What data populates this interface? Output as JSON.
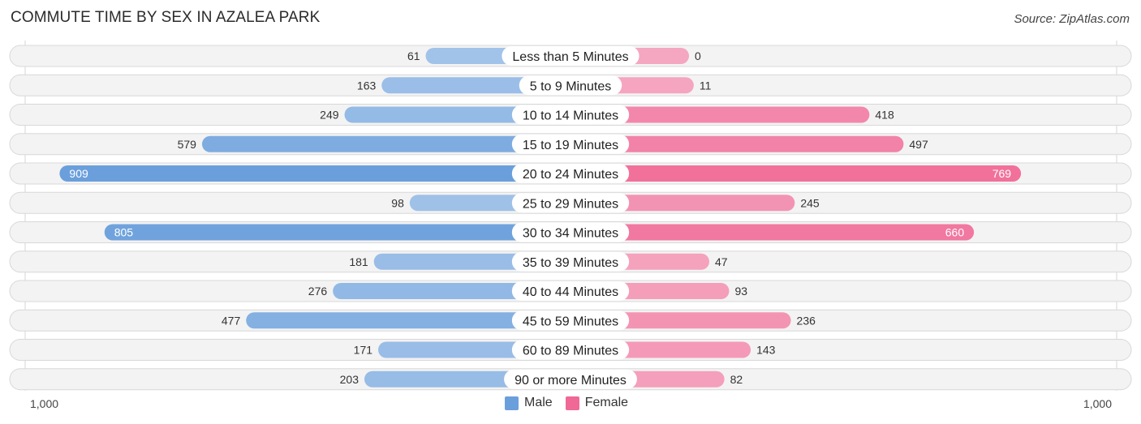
{
  "header": {
    "title": "COMMUTE TIME BY SEX IN AZALEA PARK",
    "source": "Source: ZipAtlas.com"
  },
  "colors": {
    "male_strong": "#6a9fdc",
    "male_light": "#a7c6ea",
    "female_strong": "#f06895",
    "female_light": "#f5a6c0"
  },
  "axis": {
    "left_label": "1,000",
    "right_label": "1,000"
  },
  "legend": [
    {
      "label": "Male",
      "color": "#6a9fdc"
    },
    {
      "label": "Female",
      "color": "#f06895"
    }
  ],
  "chart_data": {
    "type": "bar",
    "orientation": "horizontal-diverging",
    "title": "COMMUTE TIME BY SEX IN AZALEA PARK",
    "categories": [
      "Less than 5 Minutes",
      "5 to 9 Minutes",
      "10 to 14 Minutes",
      "15 to 19 Minutes",
      "20 to 24 Minutes",
      "25 to 29 Minutes",
      "30 to 34 Minutes",
      "35 to 39 Minutes",
      "40 to 44 Minutes",
      "45 to 59 Minutes",
      "60 to 89 Minutes",
      "90 or more Minutes"
    ],
    "series": [
      {
        "name": "Male",
        "values": [
          61,
          163,
          249,
          579,
          909,
          98,
          805,
          181,
          276,
          477,
          171,
          203
        ]
      },
      {
        "name": "Female",
        "values": [
          0,
          11,
          418,
          497,
          769,
          245,
          660,
          47,
          93,
          236,
          143,
          82
        ]
      }
    ],
    "xlim": [
      -1000,
      1000
    ],
    "tick_labels": [
      "1,000",
      "1,000"
    ],
    "legend_position": "bottom-center",
    "grid": false
  }
}
